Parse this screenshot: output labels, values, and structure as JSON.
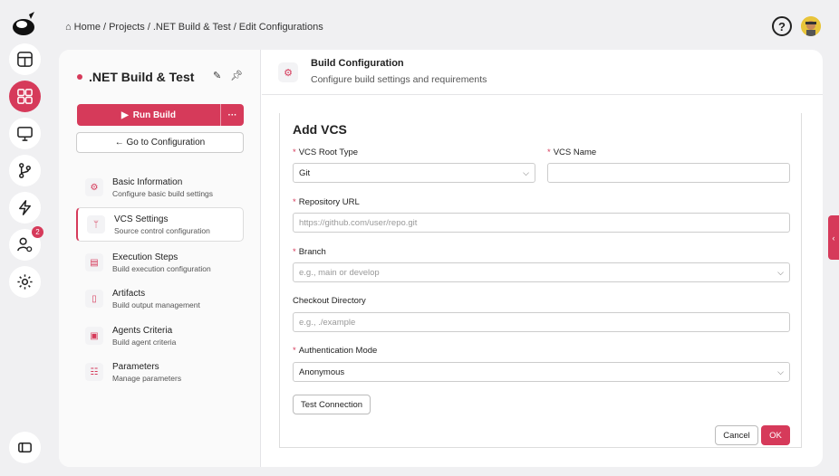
{
  "breadcrumb": {
    "home": "Home",
    "sep": "/",
    "projects": "Projects",
    "project": ".NET Build & Test",
    "current": "Edit Configurations"
  },
  "sidebar": {
    "project_title": ".NET Build & Test",
    "run_label": "Run Build",
    "more_label": "···",
    "goto_label": "← Go to Configuration",
    "items": [
      {
        "title": "Basic Information",
        "sub": "Configure basic build settings",
        "icon": "gear-icon"
      },
      {
        "title": "VCS Settings",
        "sub": "Source control configuration",
        "icon": "branch-icon"
      },
      {
        "title": "Execution Steps",
        "sub": "Build execution configuration",
        "icon": "steps-icon"
      },
      {
        "title": "Artifacts",
        "sub": "Build output management",
        "icon": "file-icon"
      },
      {
        "title": "Agents Criteria",
        "sub": "Build agent criteria",
        "icon": "agent-icon"
      },
      {
        "title": "Parameters",
        "sub": "Manage parameters",
        "icon": "sliders-icon"
      }
    ]
  },
  "header": {
    "title": "Build Configuration",
    "subtitle": "Configure build settings and requirements"
  },
  "form": {
    "title": "Add VCS",
    "required_mark": "*",
    "vcs_root_type": {
      "label": "VCS Root Type",
      "value": "Git"
    },
    "vcs_name": {
      "label": "VCS Name",
      "value": ""
    },
    "repo_url": {
      "label": "Repository URL",
      "placeholder": "https://github.com/user/repo.git"
    },
    "branch": {
      "label": "Branch",
      "placeholder": "e.g., main or develop"
    },
    "checkout_dir": {
      "label": "Checkout Directory",
      "placeholder": "e.g., ./example"
    },
    "auth_mode": {
      "label": "Authentication Mode",
      "value": "Anonymous"
    },
    "test_label": "Test Connection",
    "cancel_label": "Cancel",
    "ok_label": "OK"
  },
  "rail": {
    "notification_count": "2"
  },
  "colors": {
    "accent": "#d63a5a"
  }
}
